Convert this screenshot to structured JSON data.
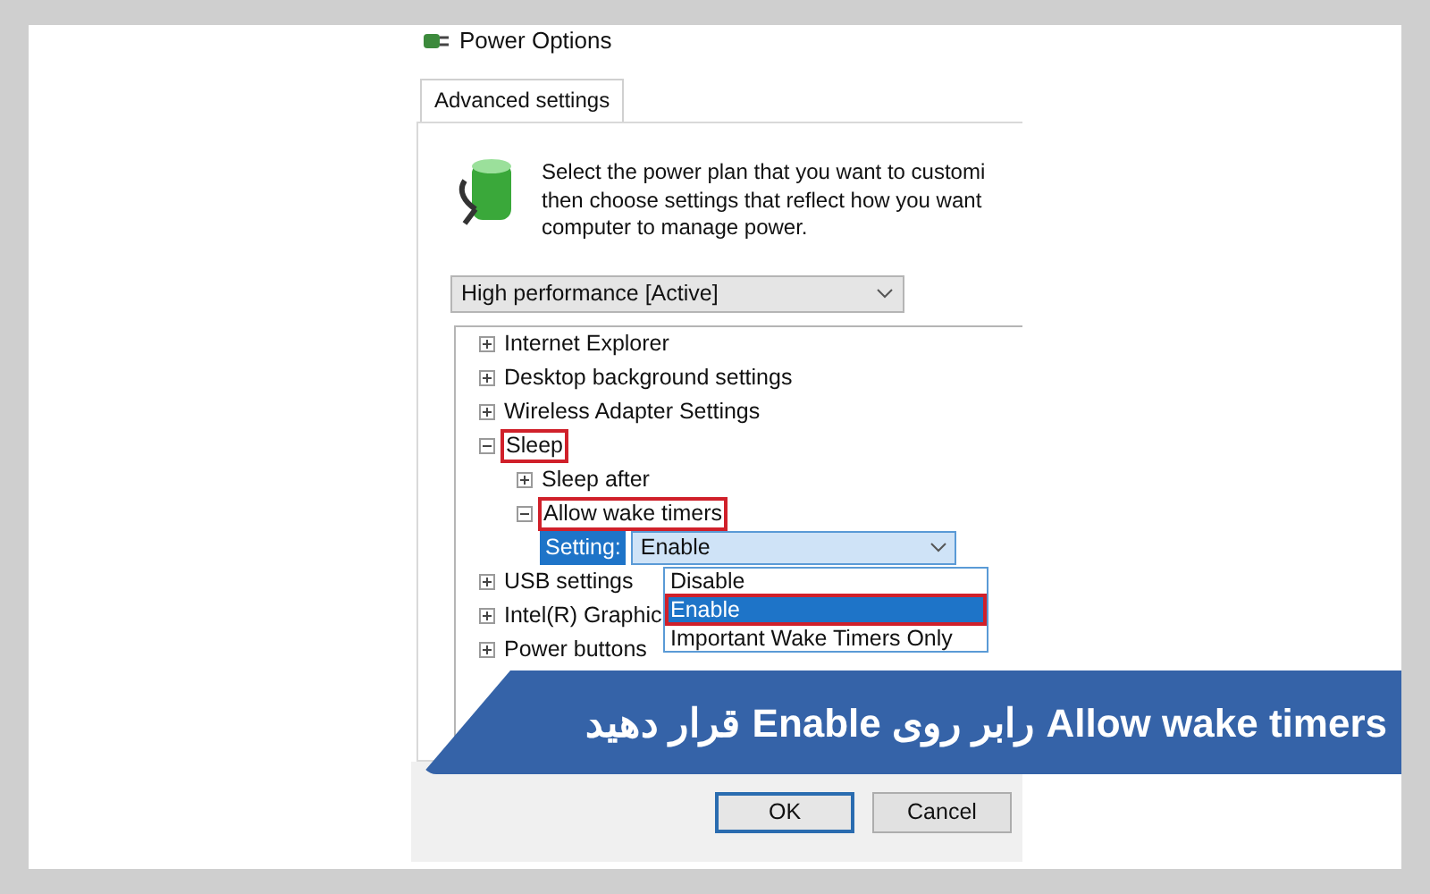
{
  "window": {
    "title": "Power Options"
  },
  "tabs": [
    {
      "label": "Advanced settings",
      "selected": true
    }
  ],
  "description": [
    "Select the power plan that you want to customi",
    "then choose settings that reflect how you want",
    "computer to manage power."
  ],
  "plan_select": {
    "value": "High performance [Active]"
  },
  "tree": [
    {
      "label": "Internet Explorer",
      "expanded": false,
      "highlighted": false
    },
    {
      "label": "Desktop background settings",
      "expanded": false,
      "highlighted": false
    },
    {
      "label": "Wireless Adapter Settings",
      "expanded": false,
      "highlighted": false
    },
    {
      "label": "Sleep",
      "expanded": true,
      "highlighted": true,
      "children": [
        {
          "label": "Sleep after",
          "expanded": false,
          "highlighted": false
        },
        {
          "label": "Allow wake timers",
          "expanded": true,
          "highlighted": true,
          "children": [
            {
              "kind": "setting",
              "label": "Setting:",
              "value": "Enable"
            }
          ]
        }
      ]
    },
    {
      "label": "USB settings",
      "expanded": false,
      "highlighted": false
    },
    {
      "label": "Intel(R) Graphic",
      "expanded": false,
      "highlighted": false
    },
    {
      "label": "Power buttons",
      "expanded": false,
      "highlighted": false
    }
  ],
  "dropdown_options": [
    {
      "label": "Disable",
      "selected": false,
      "highlighted": false
    },
    {
      "label": "Enable",
      "selected": true,
      "highlighted": true
    },
    {
      "label": "Important Wake Timers Only",
      "selected": false,
      "highlighted": false
    }
  ],
  "buttons": [
    {
      "label": "OK",
      "default": true
    },
    {
      "label": "Cancel",
      "default": false
    }
  ],
  "caption": "Allow wake timers رابر روی Enable قرار دهید"
}
